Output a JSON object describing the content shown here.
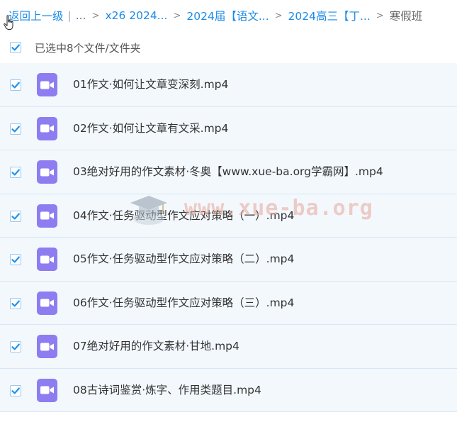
{
  "breadcrumb": {
    "back": "返回上一级",
    "ellipsis": "...",
    "items": [
      "x26 2024...",
      "2024届【语文...",
      "2024高三【丁..."
    ],
    "current": "寒假班"
  },
  "selection": {
    "text": "已选中8个文件/文件夹"
  },
  "files": [
    {
      "name": "01作文·如何让文章变深刻.mp4",
      "checked": true
    },
    {
      "name": "02作文·如何让文章有文采.mp4",
      "checked": true
    },
    {
      "name": "03绝对好用的作文素材·冬奥【www.xue-ba.org学霸网】.mp4",
      "checked": true
    },
    {
      "name": "04作文·任务驱动型作文应对策略（一）.mp4",
      "checked": true
    },
    {
      "name": "05作文·任务驱动型作文应对策略（二）.mp4",
      "checked": true
    },
    {
      "name": "06作文·任务驱动型作文应对策略（三）.mp4",
      "checked": true
    },
    {
      "name": "07绝对好用的作文素材·甘地.mp4",
      "checked": true
    },
    {
      "name": "08古诗词鉴赏·炼字、作用类题目.mp4",
      "checked": true
    }
  ],
  "watermark": "www.xue-ba.org",
  "icons": {
    "file": "video-file-icon",
    "checkbox": "checkbox-checked-icon",
    "cursor": "hand-pointer-icon"
  },
  "colors": {
    "link": "#1b8be8",
    "check": "#1e93ee",
    "icon_bg": "#8d7df0",
    "row_bg": "#f3f8fd"
  }
}
